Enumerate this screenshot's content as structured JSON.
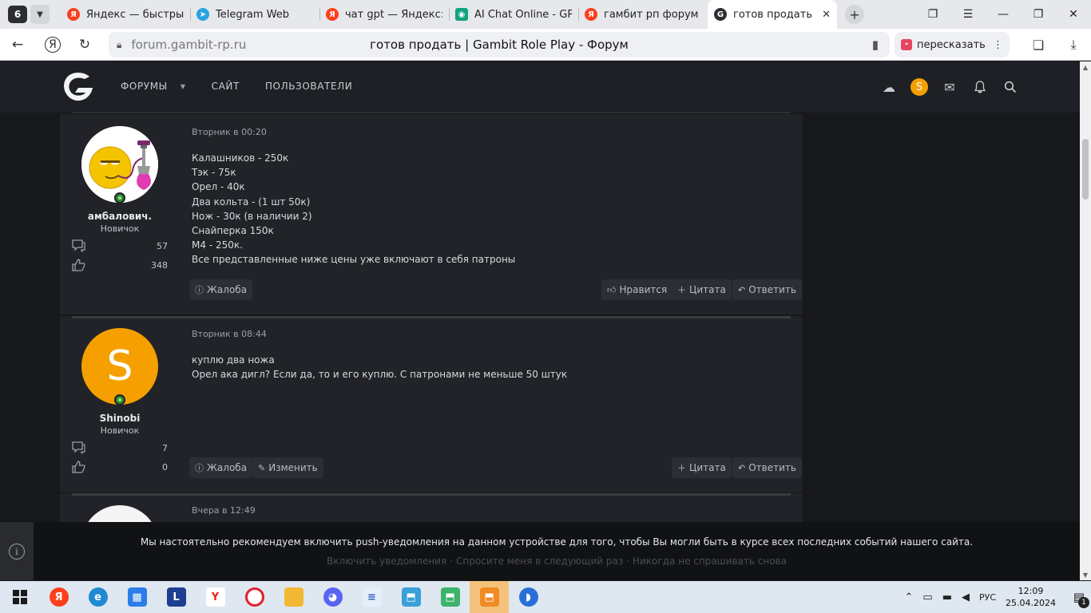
{
  "browser": {
    "tab_count": "6",
    "tabs": [
      {
        "title": "Яндекс — быстрый",
        "icon": "yandex-icon",
        "color": "#fc3f1d"
      },
      {
        "title": "Telegram Web",
        "icon": "telegram-icon",
        "color": "#2aa3e0"
      },
      {
        "title": "чат gpt — Яндекс: н",
        "icon": "yandex-icon",
        "color": "#fc3f1d"
      },
      {
        "title": "AI Chat Online - GPT",
        "icon": "ai-chat-icon",
        "color": "#10a37f"
      },
      {
        "title": "гамбит рп форум —",
        "icon": "yandex-icon",
        "color": "#fc3f1d"
      },
      {
        "title": "готов продать | Ga",
        "icon": "gambit-icon",
        "color": "#2b2d31"
      }
    ],
    "address": {
      "domain": "forum.gambit-rp.ru",
      "page_title": "готов продать | Gambit Role Play - Форум"
    },
    "retell_label": "пересказать"
  },
  "site": {
    "nav": [
      "ФОРУМЫ",
      "САЙТ",
      "ПОЛЬЗОВАТЕЛИ"
    ],
    "user_initial": "S"
  },
  "posts": [
    {
      "author": "амбалович.",
      "rank": "Новичок",
      "messages": "57",
      "reactions": "348",
      "date": "Вторник в 00:20",
      "lines": [
        "Калашников - 250к",
        "Тэк - 75к",
        "Орел - 40к",
        "Два кольта - (1 шт 50к)",
        "Нож - 30к (в наличии 2)",
        "Снайперка 150к",
        "М4 - 250к.",
        "Все представленные ниже цены уже включают в себя патроны"
      ],
      "actions": {
        "report": "Жалоба",
        "like": "Нравится",
        "quote": "Цитата",
        "reply": "Ответить"
      }
    },
    {
      "author": "Shinobi",
      "avatar_letter": "S",
      "rank": "Новичок",
      "messages": "7",
      "reactions": "0",
      "date": "Вторник в 08:44",
      "lines": [
        "куплю два ножа",
        "Орел ака дигл? Если да, то и его куплю. С патронами не меньше 50 штук"
      ],
      "actions": {
        "report": "Жалоба",
        "edit": "Изменить",
        "quote": "Цитата",
        "reply": "Ответить"
      }
    },
    {
      "date": "Вчера в 12:49"
    }
  ],
  "push_banner": {
    "message": "Мы настоятельно рекомендуем включить push-уведомления на данном устройстве для того, чтобы Вы могли быть в курсе всех последних событий нашего сайта.",
    "links": [
      "Включить уведомления",
      "Спросите меня в следующий раз",
      "Никогда не спрашивать снова"
    ]
  },
  "taskbar": {
    "language": "РУС",
    "time": "12:09",
    "date": "25.04.2024",
    "notifications": "1"
  },
  "colors": {
    "accent_orange": "#f5a000",
    "online_green": "#2a8c2a",
    "forum_bg": "#17181c",
    "post_bg": "#212328"
  }
}
